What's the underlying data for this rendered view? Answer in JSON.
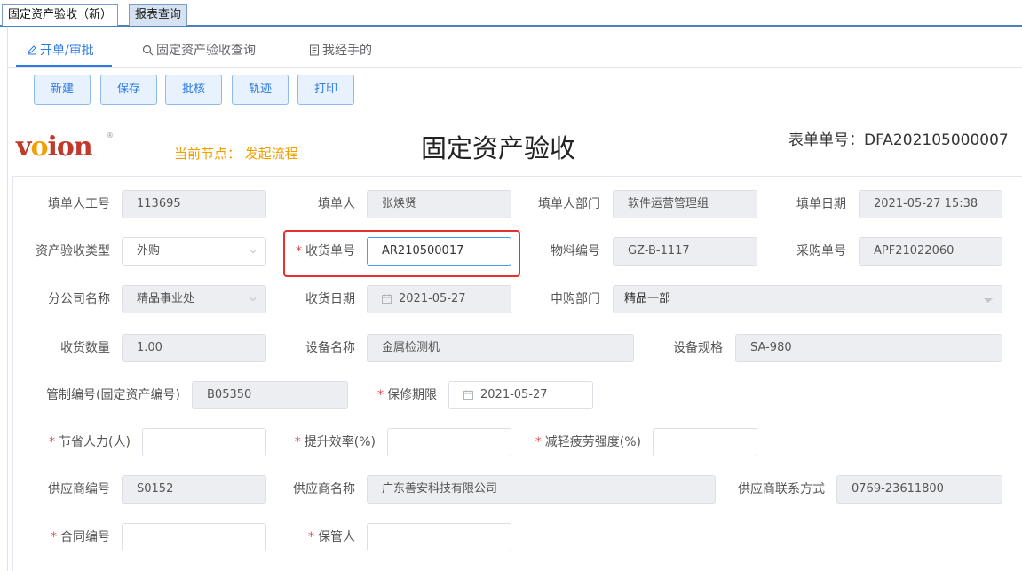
{
  "window_tabs": {
    "active": "固定资产验收（新）",
    "other": "报表查询"
  },
  "nav_tabs": [
    "开单/审批",
    "固定资产验收查询",
    "我经手的"
  ],
  "toolbar": {
    "new": "新建",
    "save": "保存",
    "approve": "批核",
    "track": "轨迹",
    "print": "打印"
  },
  "header": {
    "logo": "voion",
    "current_node": "当前节点： 发起流程",
    "title": "固定资产验收",
    "form_no": "表单单号：DFA202105000007"
  },
  "form": {
    "filler_id": {
      "label": "填单人工号",
      "value": "113695"
    },
    "filler": {
      "label": "填单人",
      "value": "张焕贤"
    },
    "filler_dept": {
      "label": "填单人部门",
      "value": "软件运营管理组"
    },
    "fill_date": {
      "label": "填单日期",
      "value": "2021-05-27 15:38"
    },
    "accept_type": {
      "label": "资产验收类型",
      "value": "外购"
    },
    "receipt_no": {
      "label": "收货单号",
      "value": "AR210500017"
    },
    "material_no": {
      "label": "物料编号",
      "value": "GZ-B-1117"
    },
    "purchase_no": {
      "label": "采购单号",
      "value": "APF21022060"
    },
    "branch": {
      "label": "分公司名称",
      "value": "精品事业处"
    },
    "receipt_date": {
      "label": "收货日期",
      "value": "2021-05-27"
    },
    "purchase_dept": {
      "label": "申购部门",
      "value": "精品一部"
    },
    "quantity": {
      "label": "收货数量",
      "value": "1.00"
    },
    "device_name": {
      "label": "设备名称",
      "value": "金属检测机"
    },
    "device_spec": {
      "label": "设备规格",
      "value": "SA-980"
    },
    "control_no": {
      "label": "管制编号(固定资产编号)",
      "value": "B05350"
    },
    "warranty": {
      "label": "保修期限",
      "value": "2021-05-27"
    },
    "manpower_saved": {
      "label": "节省人力(人)",
      "value": ""
    },
    "efficiency": {
      "label": "提升效率(%)",
      "value": ""
    },
    "fatigue": {
      "label": "减轻疲劳强度(%)",
      "value": ""
    },
    "supplier_no": {
      "label": "供应商编号",
      "value": "S0152"
    },
    "supplier_name": {
      "label": "供应商名称",
      "value": "广东善安科技有限公司"
    },
    "supplier_contact": {
      "label": "供应商联系方式",
      "value": "0769-23611800"
    },
    "contract_no": {
      "label": "合同编号",
      "value": ""
    },
    "custodian": {
      "label": "保管人",
      "value": ""
    }
  },
  "colors": {
    "accent": "#2c7be5",
    "logo": "#c0392b",
    "node": "#f0a000",
    "required": "#e64545",
    "highlight": "#e8312f"
  }
}
